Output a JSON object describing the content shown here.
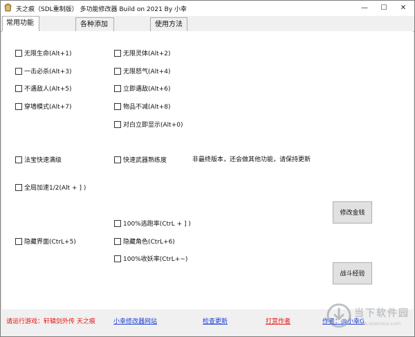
{
  "window": {
    "title": "天之痕（SDL重制版） 多功能修改器  Build on 2021 By 小幸",
    "min_glyph": "—",
    "max_glyph": "☐",
    "close_glyph": "✕"
  },
  "tabs": [
    {
      "label": "常用功能",
      "active": true
    },
    {
      "label": "各种添加",
      "active": false
    },
    {
      "label": "使用方法",
      "active": false
    }
  ],
  "options": {
    "infinite_hp": "无限生命(Alt+1)",
    "infinite_spirit": "无限灵体(Alt+2)",
    "one_hit_kill": "一击必杀(Alt+3)",
    "infinite_rage": "无限怒气(Alt+4)",
    "no_encounter": "不遇敌人(Alt+5)",
    "instant_encounter": "立即遇敌(Alt+6)",
    "wall_walk": "穿墙模式(Alt+7)",
    "items_no_decrease": "物品不减(Alt+8)",
    "instant_dialog": "对白立即显示(Alt+0)",
    "treasure_fast_max": "法宝快速满级",
    "weapon_fast_proficiency": "快速武器熟练度",
    "global_speedup": "全局加速1/2(Alt + ] )",
    "escape_rate": "100%逃跑率(CtrL + ] )",
    "hide_ui": "隐藏界面(CtrL+5)",
    "hide_character": "隐藏角色(CtrL+6)",
    "capture_rate": "100%收妖率(CtrL+~)"
  },
  "note": "非最终版本，还会做其他功能，请保持更新",
  "buttons": {
    "modify_money": "修改金钱",
    "battle_exp": "战斗经验"
  },
  "footer": {
    "run_game": "请运行游戏：轩辕剑外传 天之痕",
    "site_link": "小幸修改器网站",
    "check_update": "检查更新",
    "donate": "打赏作者",
    "author": "作者：@小幸G"
  },
  "watermark": {
    "name": "当下软件园",
    "url": "www.downxia.com"
  },
  "colors": {
    "link_blue": "#1a3fd6",
    "alert_red": "#e81111"
  }
}
